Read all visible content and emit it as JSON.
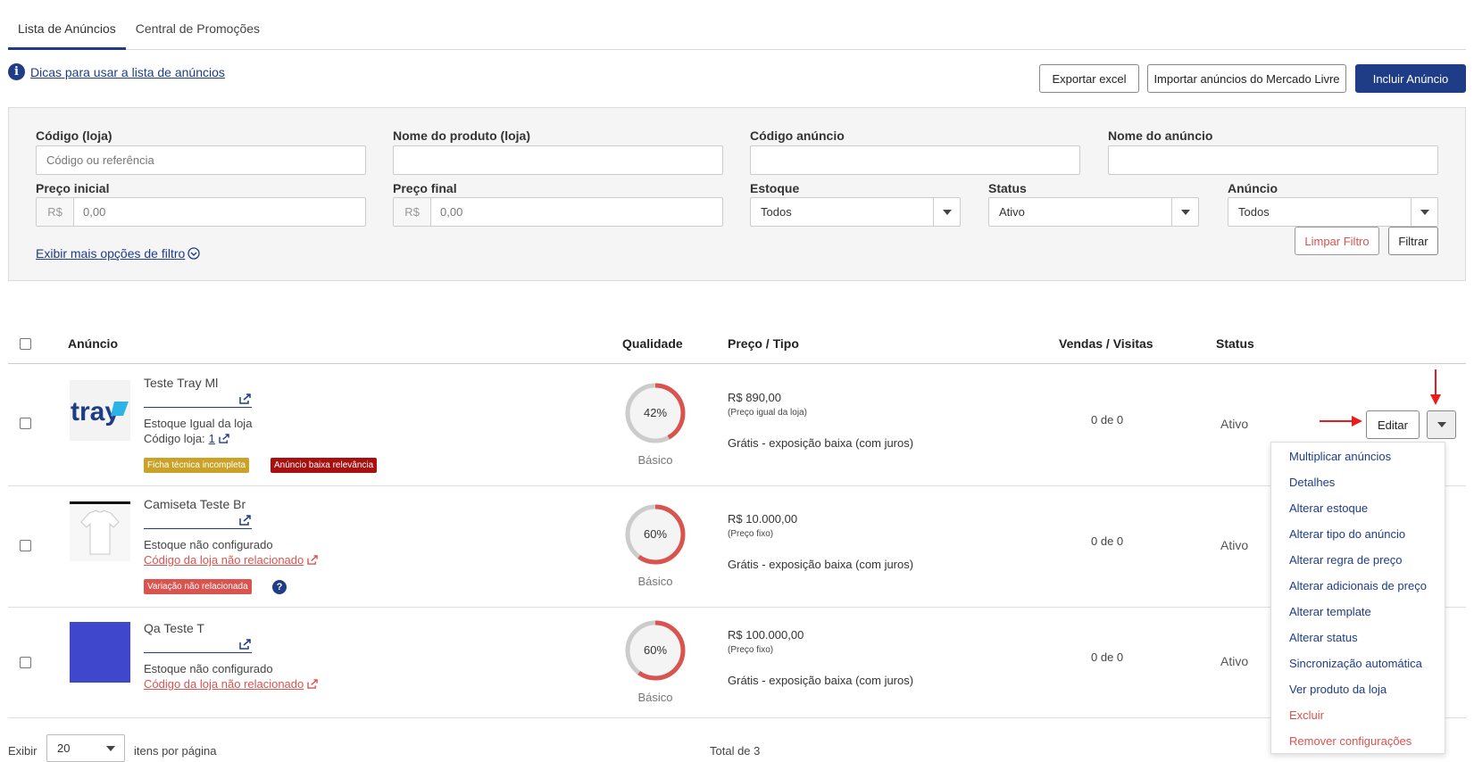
{
  "tabs": [
    {
      "label": "Lista de Anúncios",
      "active": true
    },
    {
      "label": "Central de Promoções",
      "active": false
    }
  ],
  "tips": {
    "icon": "info-icon",
    "link": "Dicas para usar a lista de anúncios"
  },
  "actions": {
    "export": "Exportar excel",
    "import": "Importar anúncios do Mercado Livre",
    "include": "Incluir Anúncio"
  },
  "filters": {
    "store_code": {
      "label": "Código (loja)",
      "placeholder": "Código ou referência"
    },
    "product_name": {
      "label": "Nome do produto (loja)",
      "value": ""
    },
    "listing_code": {
      "label": "Código anúncio",
      "value": ""
    },
    "listing_name": {
      "label": "Nome do anúncio",
      "value": ""
    },
    "price_start": {
      "label": "Preço inicial",
      "prefix": "R$",
      "value": "0,00"
    },
    "price_end": {
      "label": "Preço final",
      "prefix": "R$",
      "value": "0,00"
    },
    "stock": {
      "label": "Estoque",
      "value": "Todos"
    },
    "status": {
      "label": "Status",
      "value": "Ativo"
    },
    "listing": {
      "label": "Anúncio",
      "value": "Todos"
    },
    "more": "Exibir mais opções de filtro",
    "clear": "Limpar Filtro",
    "apply": "Filtrar"
  },
  "table": {
    "headers": {
      "listing": "Anúncio",
      "quality": "Qualidade",
      "price": "Preço / Tipo",
      "sales": "Vendas / Visitas",
      "status": "Status"
    },
    "rows": [
      {
        "title": "Teste Tray Ml",
        "stock": "Estoque Igual da loja",
        "code_label": "Código loja:",
        "code": "1",
        "tags": [
          "Ficha técnica incompleta",
          "Anúncio baixa relevância"
        ],
        "quality_pct": "42%",
        "quality_value": 42,
        "quality_label": "Básico",
        "price": "R$ 890,00",
        "price_rule": "(Preço igual da loja)",
        "type": "Grátis - exposição baixa (com juros)",
        "sales": "0 de 0",
        "status": "Ativo",
        "thumb_logo": "tray"
      },
      {
        "title": "Camiseta Teste Br",
        "stock": "Estoque não configurado",
        "code_warning": "Código da loja não relacionado",
        "tags": [
          "Variação não relacionada"
        ],
        "quality_pct": "60%",
        "quality_value": 60,
        "quality_label": "Básico",
        "price": "R$ 10.000,00",
        "price_rule": "(Preço fixo)",
        "type": "Grátis - exposição baixa (com juros)",
        "sales": "0 de 0",
        "status": "Ativo"
      },
      {
        "title": "Qa Teste T",
        "stock": "Estoque não configurado",
        "code_warning": "Código da loja não relacionado",
        "quality_pct": "60%",
        "quality_value": 60,
        "quality_label": "Básico",
        "price": "R$ 100.000,00",
        "price_rule": "(Preço fixo)",
        "type": "Grátis - exposição baixa (com juros)",
        "sales": "0 de 0",
        "status": "Ativo",
        "thumb_color": "#3f48cc"
      }
    ],
    "edit_label": "Editar"
  },
  "dropdown": [
    {
      "label": "Multiplicar anúncios"
    },
    {
      "label": "Detalhes"
    },
    {
      "label": "Alterar estoque"
    },
    {
      "label": "Alterar tipo do anúncio"
    },
    {
      "label": "Alterar regra de preço"
    },
    {
      "label": "Alterar adicionais de preço"
    },
    {
      "label": "Alterar template"
    },
    {
      "label": "Alterar status"
    },
    {
      "label": "Sincronização automática"
    },
    {
      "label": "Ver produto da loja"
    },
    {
      "label": "Excluir",
      "danger": true
    },
    {
      "label": "Remover configurações",
      "danger": true
    }
  ],
  "footer": {
    "show": "Exibir",
    "per_page_value": "20",
    "per_page_suffix": "itens por página",
    "total": "Total de 3"
  },
  "colors": {
    "primary": "#1f3c87",
    "danger": "#d9534f",
    "tag_yellow": "#c9a227",
    "tag_darkred": "#a80f0f",
    "tag_red": "#d9534f",
    "gauge_red": "#d9534f",
    "gauge_grey": "#cccccc",
    "annotation_arrow": "#e81c1c"
  }
}
